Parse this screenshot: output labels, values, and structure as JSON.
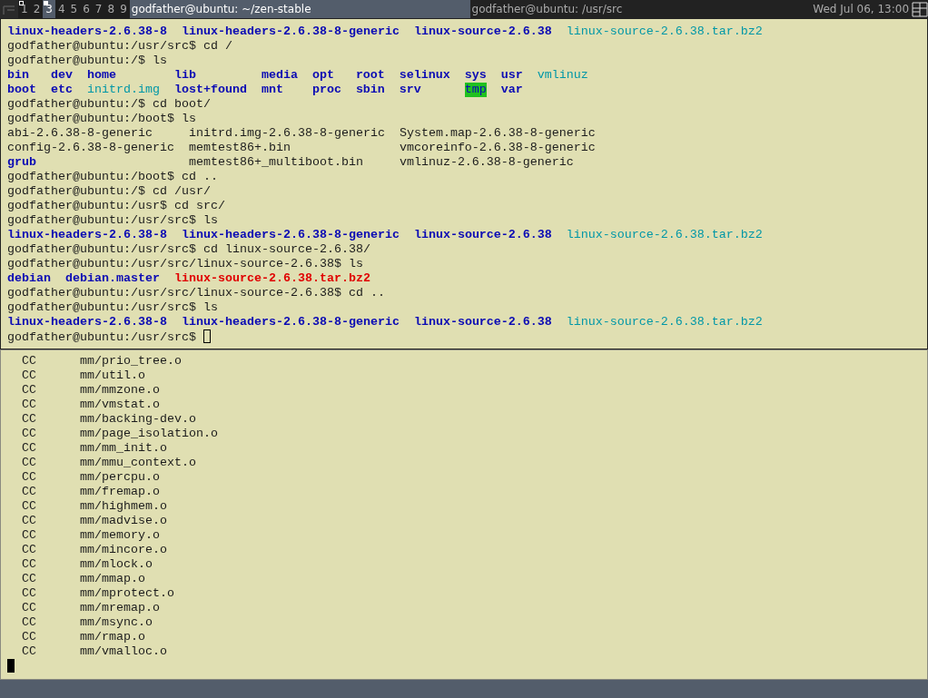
{
  "topbar": {
    "tags": [
      {
        "label": "1",
        "selected": false,
        "occupied": true
      },
      {
        "label": "2",
        "selected": false,
        "occupied": false
      },
      {
        "label": "3",
        "selected": true,
        "occupied": true
      },
      {
        "label": "4",
        "selected": false,
        "occupied": false
      },
      {
        "label": "5",
        "selected": false,
        "occupied": false
      },
      {
        "label": "6",
        "selected": false,
        "occupied": false
      },
      {
        "label": "7",
        "selected": false,
        "occupied": false
      },
      {
        "label": "8",
        "selected": false,
        "occupied": false
      },
      {
        "label": "9",
        "selected": false,
        "occupied": false
      }
    ],
    "tasks": [
      {
        "title": "godfather@ubuntu: ~/zen-stable",
        "selected": true
      },
      {
        "title": "godfather@ubuntu: /usr/src",
        "selected": false
      }
    ],
    "clock": "Wed Jul 06, 13:00"
  },
  "panes": [
    {
      "focused": false,
      "lines": [
        {
          "kind": "ls",
          "rows": [
            [
              {
                "name": "linux-headers-2.6.38-8",
                "kind": "dir"
              },
              {
                "name": "linux-headers-2.6.38-8-generic",
                "kind": "dir"
              },
              {
                "name": "linux-source-2.6.38",
                "kind": "dir"
              },
              {
                "name": "linux-source-2.6.38.tar.bz2",
                "kind": "link"
              }
            ]
          ]
        },
        {
          "kind": "text",
          "text": "godfather@ubuntu:/usr/src$ cd /"
        },
        {
          "kind": "text",
          "text": "godfather@ubuntu:/$ ls"
        },
        {
          "kind": "ls",
          "rows": [
            [
              {
                "name": "bin",
                "kind": "dir"
              },
              {
                "name": "dev",
                "kind": "dir"
              },
              {
                "name": "home",
                "kind": "dir"
              },
              {
                "name": "lib",
                "kind": "dir"
              },
              {
                "name": "media",
                "kind": "dir"
              },
              {
                "name": "opt",
                "kind": "dir"
              },
              {
                "name": "root",
                "kind": "dir"
              },
              {
                "name": "selinux",
                "kind": "dir"
              },
              {
                "name": "sys",
                "kind": "dir"
              },
              {
                "name": "usr",
                "kind": "dir"
              },
              {
                "name": "vmlinuz",
                "kind": "link"
              }
            ],
            [
              {
                "name": "boot",
                "kind": "dir"
              },
              {
                "name": "etc",
                "kind": "dir"
              },
              {
                "name": "initrd.img",
                "kind": "link"
              },
              {
                "name": "lost+found",
                "kind": "dir"
              },
              {
                "name": "mnt",
                "kind": "dir"
              },
              {
                "name": "proc",
                "kind": "dir"
              },
              {
                "name": "sbin",
                "kind": "dir"
              },
              {
                "name": "srv",
                "kind": "dir"
              },
              {
                "name": "tmp",
                "kind": "sticky"
              },
              {
                "name": "var",
                "kind": "dir"
              }
            ]
          ]
        },
        {
          "kind": "text",
          "text": "godfather@ubuntu:/$ cd boot/"
        },
        {
          "kind": "text",
          "text": "godfather@ubuntu:/boot$ ls"
        },
        {
          "kind": "ls",
          "rows": [
            [
              {
                "name": "abi-2.6.38-8-generic",
                "kind": "file"
              },
              {
                "name": "initrd.img-2.6.38-8-generic",
                "kind": "file"
              },
              {
                "name": "System.map-2.6.38-8-generic",
                "kind": "file"
              }
            ],
            [
              {
                "name": "config-2.6.38-8-generic",
                "kind": "file"
              },
              {
                "name": "memtest86+.bin",
                "kind": "file"
              },
              {
                "name": "vmcoreinfo-2.6.38-8-generic",
                "kind": "file"
              }
            ],
            [
              {
                "name": "grub",
                "kind": "dir"
              },
              {
                "name": "memtest86+_multiboot.bin",
                "kind": "file"
              },
              {
                "name": "vmlinuz-2.6.38-8-generic",
                "kind": "file"
              }
            ]
          ]
        },
        {
          "kind": "text",
          "text": "godfather@ubuntu:/boot$ cd .."
        },
        {
          "kind": "text",
          "text": "godfather@ubuntu:/$ cd /usr/"
        },
        {
          "kind": "text",
          "text": "godfather@ubuntu:/usr$ cd src/"
        },
        {
          "kind": "text",
          "text": "godfather@ubuntu:/usr/src$ ls"
        },
        {
          "kind": "ls",
          "rows": [
            [
              {
                "name": "linux-headers-2.6.38-8",
                "kind": "dir"
              },
              {
                "name": "linux-headers-2.6.38-8-generic",
                "kind": "dir"
              },
              {
                "name": "linux-source-2.6.38",
                "kind": "dir"
              },
              {
                "name": "linux-source-2.6.38.tar.bz2",
                "kind": "link"
              }
            ]
          ]
        },
        {
          "kind": "text",
          "text": "godfather@ubuntu:/usr/src$ cd linux-source-2.6.38/"
        },
        {
          "kind": "text",
          "text": "godfather@ubuntu:/usr/src/linux-source-2.6.38$ ls"
        },
        {
          "kind": "ls",
          "rows": [
            [
              {
                "name": "debian",
                "kind": "dir"
              },
              {
                "name": "debian.master",
                "kind": "dir"
              },
              {
                "name": "linux-source-2.6.38.tar.bz2",
                "kind": "archive"
              }
            ]
          ]
        },
        {
          "kind": "text",
          "text": "godfather@ubuntu:/usr/src/linux-source-2.6.38$ cd .."
        },
        {
          "kind": "text",
          "text": "godfather@ubuntu:/usr/src$ ls"
        },
        {
          "kind": "ls",
          "rows": [
            [
              {
                "name": "linux-headers-2.6.38-8",
                "kind": "dir"
              },
              {
                "name": "linux-headers-2.6.38-8-generic",
                "kind": "dir"
              },
              {
                "name": "linux-source-2.6.38",
                "kind": "dir"
              },
              {
                "name": "linux-source-2.6.38.tar.bz2",
                "kind": "link"
              }
            ]
          ]
        },
        {
          "kind": "text",
          "text": "godfather@ubuntu:/usr/src$",
          "cursor": true
        }
      ]
    },
    {
      "focused": true,
      "lines": [
        {
          "kind": "build",
          "action": "CC",
          "target": "mm/prio_tree.o"
        },
        {
          "kind": "build",
          "action": "CC",
          "target": "mm/util.o"
        },
        {
          "kind": "build",
          "action": "CC",
          "target": "mm/mmzone.o"
        },
        {
          "kind": "build",
          "action": "CC",
          "target": "mm/vmstat.o"
        },
        {
          "kind": "build",
          "action": "CC",
          "target": "mm/backing-dev.o"
        },
        {
          "kind": "build",
          "action": "CC",
          "target": "mm/page_isolation.o"
        },
        {
          "kind": "build",
          "action": "CC",
          "target": "mm/mm_init.o"
        },
        {
          "kind": "build",
          "action": "CC",
          "target": "mm/mmu_context.o"
        },
        {
          "kind": "build",
          "action": "CC",
          "target": "mm/percpu.o"
        },
        {
          "kind": "build",
          "action": "CC",
          "target": "mm/fremap.o"
        },
        {
          "kind": "build",
          "action": "CC",
          "target": "mm/highmem.o"
        },
        {
          "kind": "build",
          "action": "CC",
          "target": "mm/madvise.o"
        },
        {
          "kind": "build",
          "action": "CC",
          "target": "mm/memory.o"
        },
        {
          "kind": "build",
          "action": "CC",
          "target": "mm/mincore.o"
        },
        {
          "kind": "build",
          "action": "CC",
          "target": "mm/mlock.o"
        },
        {
          "kind": "build",
          "action": "CC",
          "target": "mm/mmap.o"
        },
        {
          "kind": "build",
          "action": "CC",
          "target": "mm/mprotect.o"
        },
        {
          "kind": "build",
          "action": "CC",
          "target": "mm/mremap.o"
        },
        {
          "kind": "build",
          "action": "CC",
          "target": "mm/msync.o"
        },
        {
          "kind": "build",
          "action": "CC",
          "target": "mm/rmap.o"
        },
        {
          "kind": "build",
          "action": "CC",
          "target": "mm/vmalloc.o"
        },
        {
          "kind": "blank",
          "cursor": true
        }
      ]
    }
  ]
}
